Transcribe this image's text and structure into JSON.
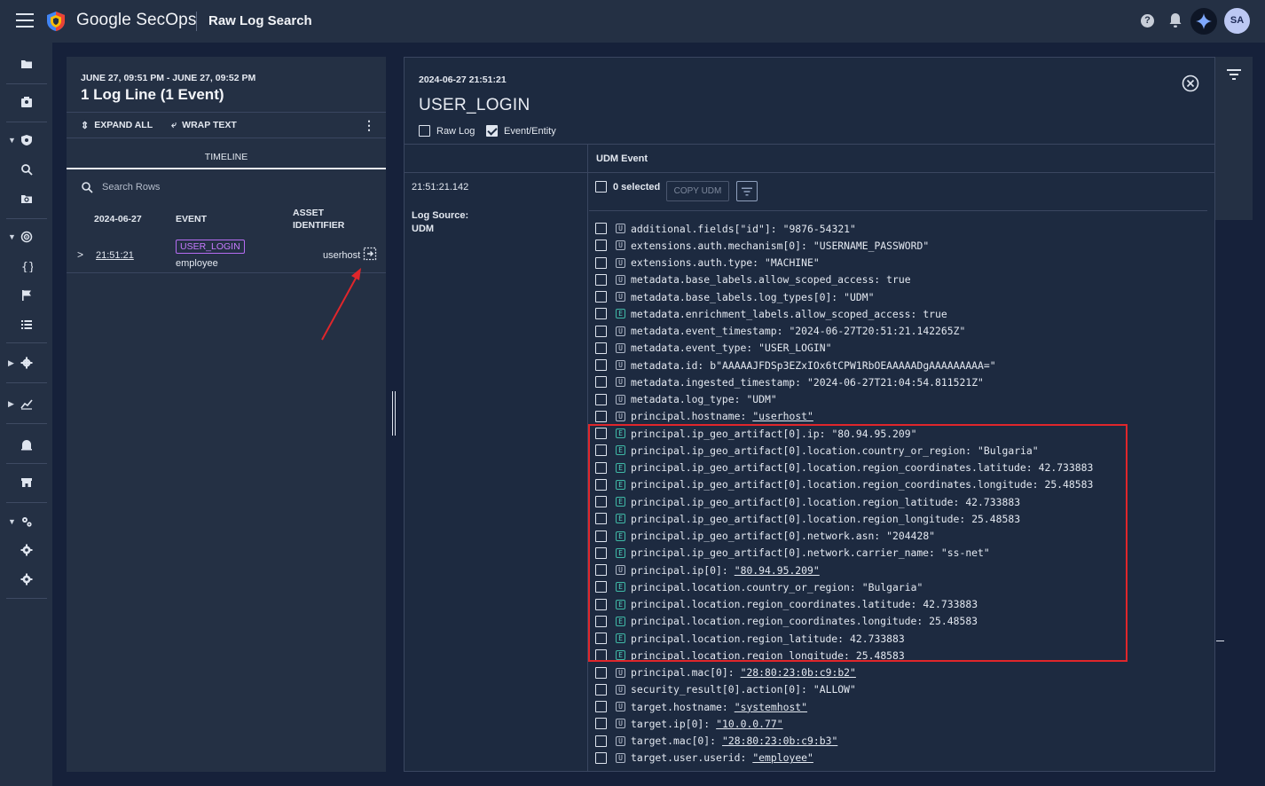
{
  "header": {
    "brand": "Google SecOps",
    "page_title": "Raw Log Search",
    "avatar_initials": "SA"
  },
  "left_panel": {
    "time_range": "JUNE 27, 09:51 PM - JUNE 27, 09:52 PM",
    "count_title": "1 Log Line (1 Event)",
    "expand_all": "EXPAND ALL",
    "wrap_text": "WRAP TEXT",
    "tab": "TIMELINE",
    "search_placeholder": "Search Rows",
    "columns": {
      "date": "2024-06-27",
      "event": "EVENT",
      "asset_line1": "ASSET",
      "asset_line2": "IDENTIFIER"
    },
    "row": {
      "time": "21:51:21",
      "event": "USER_LOGIN",
      "user": "employee",
      "asset": "userhost"
    }
  },
  "detail": {
    "timestamp": "2024-06-27 21:51:21",
    "title": "USER_LOGIN",
    "raw_log_label": "Raw Log",
    "event_entity_label": "Event/Entity",
    "udm_header": "UDM Event",
    "meta_time": "21:51:21.142",
    "log_source_label": "Log Source:",
    "log_source_value": "UDM",
    "selected": "0 selected",
    "copy_udm": "COPY UDM",
    "fields": [
      {
        "tag": "U",
        "key": "additional.fields[\"id\"]:",
        "value": "\"9876-54321\"",
        "link": false
      },
      {
        "tag": "U",
        "key": "extensions.auth.mechanism[0]:",
        "value": "\"USERNAME_PASSWORD\"",
        "link": false
      },
      {
        "tag": "U",
        "key": "extensions.auth.type:",
        "value": "\"MACHINE\"",
        "link": false
      },
      {
        "tag": "U",
        "key": "metadata.base_labels.allow_scoped_access:",
        "value": "true",
        "link": false
      },
      {
        "tag": "U",
        "key": "metadata.base_labels.log_types[0]:",
        "value": "\"UDM\"",
        "link": false
      },
      {
        "tag": "E",
        "key": "metadata.enrichment_labels.allow_scoped_access:",
        "value": "true",
        "link": false
      },
      {
        "tag": "U",
        "key": "metadata.event_timestamp:",
        "value": "\"2024-06-27T20:51:21.142265Z\"",
        "link": false
      },
      {
        "tag": "U",
        "key": "metadata.event_type:",
        "value": "\"USER_LOGIN\"",
        "link": false
      },
      {
        "tag": "U",
        "key": "metadata.id:",
        "value": "b\"AAAAAJFDSp3EZxIOx6tCPW1RbOEAAAAADgAAAAAAAAA=\"",
        "link": false
      },
      {
        "tag": "U",
        "key": "metadata.ingested_timestamp:",
        "value": "\"2024-06-27T21:04:54.811521Z\"",
        "link": false
      },
      {
        "tag": "U",
        "key": "metadata.log_type:",
        "value": "\"UDM\"",
        "link": false
      },
      {
        "tag": "U",
        "key": "principal.hostname:",
        "value": "\"userhost\"",
        "link": true
      },
      {
        "tag": "E",
        "key": "principal.ip_geo_artifact[0].ip:",
        "value": "\"80.94.95.209\"",
        "link": false
      },
      {
        "tag": "E",
        "key": "principal.ip_geo_artifact[0].location.country_or_region:",
        "value": "\"Bulgaria\"",
        "link": false
      },
      {
        "tag": "E",
        "key": "principal.ip_geo_artifact[0].location.region_coordinates.latitude:",
        "value": "42.733883",
        "link": false
      },
      {
        "tag": "E",
        "key": "principal.ip_geo_artifact[0].location.region_coordinates.longitude:",
        "value": "25.48583",
        "link": false
      },
      {
        "tag": "E",
        "key": "principal.ip_geo_artifact[0].location.region_latitude:",
        "value": "42.733883",
        "link": false
      },
      {
        "tag": "E",
        "key": "principal.ip_geo_artifact[0].location.region_longitude:",
        "value": "25.48583",
        "link": false
      },
      {
        "tag": "E",
        "key": "principal.ip_geo_artifact[0].network.asn:",
        "value": "\"204428\"",
        "link": false
      },
      {
        "tag": "E",
        "key": "principal.ip_geo_artifact[0].network.carrier_name:",
        "value": "\"ss-net\"",
        "link": false
      },
      {
        "tag": "U",
        "key": "principal.ip[0]:",
        "value": "\"80.94.95.209\"",
        "link": true
      },
      {
        "tag": "E",
        "key": "principal.location.country_or_region:",
        "value": "\"Bulgaria\"",
        "link": false
      },
      {
        "tag": "E",
        "key": "principal.location.region_coordinates.latitude:",
        "value": "42.733883",
        "link": false
      },
      {
        "tag": "E",
        "key": "principal.location.region_coordinates.longitude:",
        "value": "25.48583",
        "link": false
      },
      {
        "tag": "E",
        "key": "principal.location.region_latitude:",
        "value": "42.733883",
        "link": false
      },
      {
        "tag": "E",
        "key": "principal.location.region_longitude:",
        "value": "25.48583",
        "link": false
      },
      {
        "tag": "U",
        "key": "principal.mac[0]:",
        "value": "\"28:80:23:0b:c9:b2\"",
        "link": true
      },
      {
        "tag": "U",
        "key": "security_result[0].action[0]:",
        "value": "\"ALLOW\"",
        "link": false
      },
      {
        "tag": "U",
        "key": "target.hostname:",
        "value": "\"systemhost\"",
        "link": true
      },
      {
        "tag": "U",
        "key": "target.ip[0]:",
        "value": "\"10.0.0.77\"",
        "link": true
      },
      {
        "tag": "U",
        "key": "target.mac[0]:",
        "value": "\"28:80:23:0b:c9:b3\"",
        "link": true
      },
      {
        "tag": "U",
        "key": "target.user.userid:",
        "value": "\"employee\"",
        "link": true
      }
    ]
  },
  "colors": {
    "accent_purple": "#c77bff",
    "entity_tag": "#4dd0bc",
    "highlight_red": "#e0262b"
  }
}
